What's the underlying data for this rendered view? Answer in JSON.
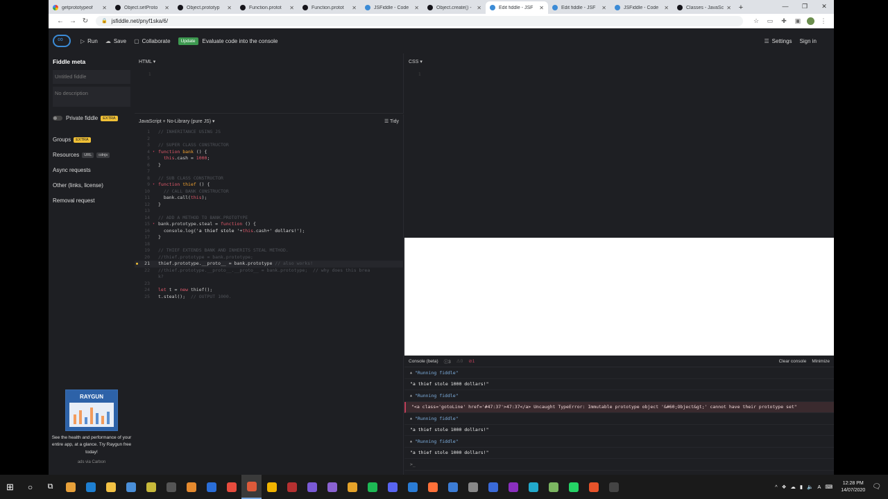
{
  "browser": {
    "tabs": [
      {
        "label": "getprototypeof",
        "icon": "google-icon"
      },
      {
        "label": "Object.setProto",
        "icon": "mdn-icon"
      },
      {
        "label": "Object.prototyp",
        "icon": "mdn-icon"
      },
      {
        "label": "Function.protot",
        "icon": "mdn-icon"
      },
      {
        "label": "Function.protot",
        "icon": "mdn-icon"
      },
      {
        "label": "JSFiddle - Code",
        "icon": "jsfiddle-icon"
      },
      {
        "label": "Object.create() -",
        "icon": "mdn-icon"
      },
      {
        "label": "Edit fiddle - JSF",
        "icon": "jsfiddle-icon",
        "active": true
      },
      {
        "label": "Edit fiddle - JSF",
        "icon": "jsfiddle-icon"
      },
      {
        "label": "JSFiddle - Code",
        "icon": "jsfiddle-icon"
      },
      {
        "label": "Classes - JavaSc",
        "icon": "mdn-icon"
      }
    ],
    "url": "jsfiddle.net/pnyf1ska/6/"
  },
  "header": {
    "run": "Run",
    "save": "Save",
    "collaborate": "Collaborate",
    "update_badge": "Update",
    "update_text": "Evaluate code into the console",
    "settings": "Settings",
    "signin": "Sign in"
  },
  "sidebar": {
    "title": "Fiddle meta",
    "title_placeholder": "Untitled fiddle",
    "desc_placeholder": "No description",
    "private": "Private fiddle",
    "extra": "EXTRA",
    "groups": "Groups",
    "resources": "Resources",
    "url_badge": "URL",
    "cdnjs_badge": "cdnjs",
    "async": "Async requests",
    "other": "Other (links, license)",
    "removal": "Removal request",
    "ad_brand": "RAYGUN",
    "ad_text": "See the health and performance of your entire app, at a glance. Try Raygun free today!",
    "ad_via": "ads via Carbon"
  },
  "panels": {
    "html": "HTML ▾",
    "css": "CSS ▾",
    "js": "JavaScript + No-Library (pure JS) ▾",
    "tidy": "Tidy",
    "line1": "1"
  },
  "code": [
    {
      "n": "1",
      "t": [
        [
          "c-cm",
          "// INHERITANCE USING JS"
        ]
      ]
    },
    {
      "n": "2",
      "t": []
    },
    {
      "n": "3",
      "t": [
        [
          "c-cm",
          "// SUPER CLASS CONSTRUCTOR"
        ]
      ]
    },
    {
      "n": "4",
      "fold": true,
      "t": [
        [
          "c-kw",
          "function "
        ],
        [
          "c-fn",
          "bank "
        ],
        [
          "c-id",
          "() {"
        ]
      ]
    },
    {
      "n": "5",
      "t": [
        [
          "c-id",
          "  "
        ],
        [
          "c-kw",
          "this"
        ],
        [
          "c-id",
          ".cash = "
        ],
        [
          "c-num",
          "1000"
        ],
        [
          "c-id",
          ";"
        ]
      ]
    },
    {
      "n": "6",
      "t": [
        [
          "c-id",
          "}"
        ]
      ]
    },
    {
      "n": "7",
      "t": []
    },
    {
      "n": "8",
      "t": [
        [
          "c-cm",
          "// SUB CLASS CONSTRUCTOR"
        ]
      ]
    },
    {
      "n": "9",
      "fold": true,
      "t": [
        [
          "c-kw",
          "function "
        ],
        [
          "c-fn",
          "thief "
        ],
        [
          "c-id",
          "() {"
        ]
      ]
    },
    {
      "n": "10",
      "t": [
        [
          "c-cm",
          "  // CALL BANK CONSTRUCTOR"
        ]
      ]
    },
    {
      "n": "11",
      "t": [
        [
          "c-id",
          "  bank.call("
        ],
        [
          "c-kw",
          "this"
        ],
        [
          "c-id",
          ");"
        ]
      ]
    },
    {
      "n": "12",
      "t": [
        [
          "c-id",
          "}"
        ]
      ]
    },
    {
      "n": "13",
      "t": []
    },
    {
      "n": "14",
      "t": [
        [
          "c-cm",
          "// ADD A METHOD TO BANK.PROTOTYPE"
        ]
      ]
    },
    {
      "n": "15",
      "fold": true,
      "t": [
        [
          "c-id",
          "bank.prototype.steal = "
        ],
        [
          "c-kw",
          "function "
        ],
        [
          "c-id",
          "() {"
        ]
      ]
    },
    {
      "n": "16",
      "t": [
        [
          "c-id",
          "  console.log("
        ],
        [
          "c-str",
          "'a thief stole '"
        ],
        [
          "c-id",
          "+"
        ],
        [
          "c-kw",
          "this"
        ],
        [
          "c-id",
          ".cash+"
        ],
        [
          "c-str",
          "' dollars!'"
        ],
        [
          "c-id",
          ");"
        ]
      ]
    },
    {
      "n": "17",
      "t": [
        [
          "c-id",
          "}"
        ]
      ]
    },
    {
      "n": "18",
      "t": []
    },
    {
      "n": "19",
      "t": [
        [
          "c-cm",
          "// THIEF EXTENDS BANK AND INHERITS STEAL METHOD."
        ]
      ]
    },
    {
      "n": "20",
      "t": [
        [
          "c-cm",
          "//thief.prototype = bank.prototype;"
        ]
      ]
    },
    {
      "n": "21",
      "active": true,
      "t": [
        [
          "c-id",
          "thief.prototype.__proto__ = bank.prototype "
        ],
        [
          "c-cm",
          "// also works!"
        ]
      ]
    },
    {
      "n": "22",
      "t": [
        [
          "c-cm",
          "//thief.prototype.__proto__.__proto__ = bank.prototype;  // why does this brea"
        ]
      ]
    },
    {
      "n": "",
      "t": [
        [
          "c-cm",
          "k?"
        ]
      ]
    },
    {
      "n": "23",
      "t": []
    },
    {
      "n": "24",
      "t": [
        [
          "c-kw",
          "let "
        ],
        [
          "c-id",
          "t = "
        ],
        [
          "c-kw",
          "new "
        ],
        [
          "c-id",
          "thief();"
        ]
      ]
    },
    {
      "n": "25",
      "t": [
        [
          "c-id",
          "t.steal();  "
        ],
        [
          "c-cm",
          "// OUTPUT 1000."
        ]
      ]
    }
  ],
  "console": {
    "title": "Console (beta)",
    "count_info": "3",
    "count_warn": "0",
    "count_err": "1",
    "clear": "Clear console",
    "minimize": "Minimize",
    "rows": [
      {
        "type": "info",
        "text": "\"Running fiddle\""
      },
      {
        "type": "log",
        "text": "\"a thief stole 1000 dollars!\""
      },
      {
        "type": "info",
        "text": "\"Running fiddle\""
      },
      {
        "type": "err",
        "text": "\"<a class='gotoLine' href='#47:37'>47:37</a> Uncaught TypeError: Immutable prototype object '&#60;Object&gt;' cannot have their prototype set\""
      },
      {
        "type": "info",
        "text": "\"Running fiddle\""
      },
      {
        "type": "log",
        "text": "\"a thief stole 1000 dollars!\""
      },
      {
        "type": "info",
        "text": "\"Running fiddle\""
      },
      {
        "type": "log",
        "text": "\"a thief stole 1000 dollars!\""
      },
      {
        "type": "prompt",
        "text": ">_"
      }
    ]
  },
  "taskbar": {
    "time": "12:28 PM",
    "date": "14/07/2020",
    "lang": "A",
    "icon_colors": [
      "#e8a13a",
      "#1e7fd1",
      "#f3c244",
      "#4a8fd8",
      "#c8b93a",
      "#555",
      "#e68a2e",
      "#2a6ed8",
      "#e84c3d",
      "#dd5a3a",
      "#f2b400",
      "#b53030",
      "#7a5ad6",
      "#8a62d2",
      "#e6a329",
      "#1db954",
      "#5865f2",
      "#2a7cd6",
      "#ff7139",
      "#3c7dd6",
      "#888",
      "#3a6ad8",
      "#8b2fbf",
      "#22aacc",
      "#7bb661",
      "#25d366",
      "#e8532a",
      "#444"
    ]
  }
}
